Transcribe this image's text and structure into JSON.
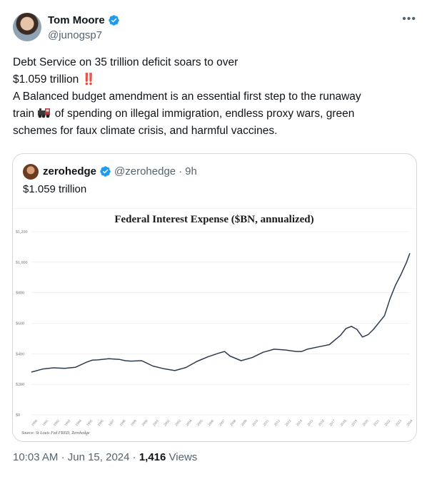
{
  "author": {
    "name": "Tom Moore",
    "handle": "@junogsp7"
  },
  "tweet": {
    "line1": "Debt Service on 35 trillion deficit soars to over",
    "line2": "$1.059 trillion",
    "line2_emoji": "‼️",
    "line3": "A Balanced budget amendment is an essential first step to the runaway",
    "line4_before": "train",
    "line4_after": "of spending on illegal immigration, endless proxy wars, green",
    "line5": "schemes for faux climate crisis, and harmful vaccines."
  },
  "quote": {
    "name": "zerohedge",
    "handle": "@zerohedge",
    "separator": "·",
    "time": "9h",
    "text": "$1.059 trillion"
  },
  "meta": {
    "time": "10:03 AM",
    "separator1": "·",
    "date": "Jun 15, 2024",
    "separator2": "·",
    "views_count": "1,416",
    "views_label": "Views"
  },
  "colors": {
    "verified": "#1d9bf0",
    "line": "#2e3b4e",
    "text_secondary": "#536471"
  },
  "chart_data": {
    "type": "line",
    "title": "Federal Interest Expense ($BN, annualized)",
    "source": "Source: St Louis Fed FRED, Zerohedge",
    "ytick_labels": [
      "$0",
      "$200",
      "$400",
      "$600",
      "$800",
      "$1,000",
      "$1,200"
    ],
    "yticks": [
      0,
      200,
      400,
      600,
      800,
      1000,
      1200
    ],
    "ylim": [
      0,
      1200
    ],
    "xlim": [
      1990,
      2024.3
    ],
    "xtick_labels": [
      "1990",
      "1991",
      "1992",
      "1993",
      "1994",
      "1995",
      "1996",
      "1997",
      "1998",
      "1999",
      "2000",
      "2001",
      "2002",
      "2003",
      "2004",
      "2005",
      "2006",
      "2007",
      "2008",
      "2009",
      "2010",
      "2011",
      "2012",
      "2013",
      "2014",
      "2015",
      "2016",
      "2017",
      "2018",
      "2019",
      "2020",
      "2021",
      "2022",
      "2023",
      "2024"
    ],
    "grid": true,
    "series": [
      {
        "x": [
          1990,
          1991,
          1992,
          1993,
          1994,
          1995,
          1995.5,
          1996,
          1997,
          1998,
          1998.5,
          1999,
          2000,
          2001,
          2002,
          2003,
          2004,
          2005,
          2006,
          2007,
          2007.5,
          2008,
          2009,
          2010,
          2011,
          2012,
          2013,
          2014,
          2014.5,
          2015,
          2016,
          2017,
          2018,
          2018.5,
          2019,
          2019.5,
          2020,
          2020.5,
          2021,
          2022,
          2022.5,
          2023,
          2023.5,
          2024,
          2024.3
        ],
        "y": [
          280,
          300,
          308,
          305,
          312,
          345,
          358,
          360,
          368,
          363,
          355,
          352,
          355,
          320,
          302,
          290,
          310,
          350,
          380,
          405,
          415,
          385,
          355,
          375,
          410,
          430,
          425,
          415,
          415,
          430,
          445,
          460,
          520,
          565,
          580,
          560,
          510,
          525,
          560,
          650,
          760,
          850,
          920,
          1000,
          1059
        ]
      }
    ]
  }
}
